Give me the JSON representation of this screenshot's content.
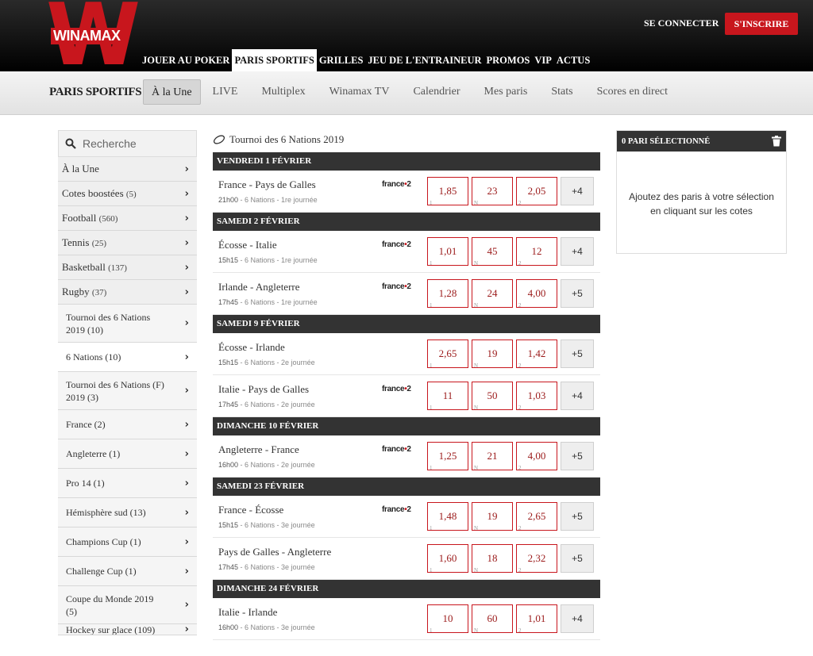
{
  "brand": {
    "name": "WINAMAX",
    "letter": "W",
    "red": "#c8161d"
  },
  "topnav": {
    "items": [
      "JOUER AU POKER",
      "PARIS SPORTIFS",
      "GRILLES",
      "JEU DE L'ENTRAINEUR",
      "PROMOS",
      "VIP",
      "ACTUS"
    ],
    "active": "PARIS SPORTIFS",
    "login": "SE CONNECTER",
    "register": "S'INSCRIRE"
  },
  "subnav": {
    "title": "PARIS SPORTIFS",
    "items": [
      "À la Une",
      "LIVE",
      "Multiplex",
      "Winamax TV",
      "Calendrier",
      "Mes paris",
      "Stats",
      "Scores en direct"
    ],
    "active": "À la Une"
  },
  "sidebar": {
    "search_placeholder": "Recherche",
    "top_items": [
      {
        "label": "À la Une",
        "count": ""
      },
      {
        "label": "Cotes boostées",
        "count": "(5)"
      },
      {
        "label": "Football",
        "count": "(560)"
      },
      {
        "label": "Tennis",
        "count": "(25)"
      },
      {
        "label": "Basketball",
        "count": "(137)"
      },
      {
        "label": "Rugby",
        "count": "(37)"
      }
    ],
    "sub_items": [
      {
        "label": "Tournoi des 6 Nations 2019 (10)",
        "selected": false
      },
      {
        "label": "6 Nations (10)",
        "selected": true
      },
      {
        "label": "Tournoi des 6 Nations (F) 2019 (3)",
        "selected": false
      },
      {
        "label": "France (2)",
        "selected": false
      },
      {
        "label": "Angleterre (1)",
        "selected": false
      },
      {
        "label": "Pro 14 (1)",
        "selected": false
      },
      {
        "label": "Hémisphère sud (13)",
        "selected": false
      },
      {
        "label": "Champions Cup (1)",
        "selected": false
      },
      {
        "label": "Challenge Cup (1)",
        "selected": false
      },
      {
        "label": "Coupe du Monde 2019 (5)",
        "selected": false
      },
      {
        "label": "Hockey sur glace (109)",
        "selected": false
      }
    ]
  },
  "content": {
    "title": "Tournoi des 6 Nations 2019",
    "tv_label": "france",
    "tv_channel": "2",
    "days": [
      {
        "day": "VENDREDI 1 FÉVRIER",
        "matches": [
          {
            "name": "France - Pays de Galles",
            "time": "21h00",
            "info": "6 Nations - 1re journée",
            "tv": true,
            "odds": [
              "1,85",
              "23",
              "2,05"
            ],
            "more": "+4"
          }
        ]
      },
      {
        "day": "SAMEDI 2 FÉVRIER",
        "matches": [
          {
            "name": "Écosse - Italie",
            "time": "15h15",
            "info": "6 Nations - 1re journée",
            "tv": true,
            "odds": [
              "1,01",
              "45",
              "12"
            ],
            "more": "+4"
          },
          {
            "name": "Irlande - Angleterre",
            "time": "17h45",
            "info": "6 Nations - 1re journée",
            "tv": true,
            "odds": [
              "1,28",
              "24",
              "4,00"
            ],
            "more": "+5"
          }
        ]
      },
      {
        "day": "SAMEDI 9 FÉVRIER",
        "matches": [
          {
            "name": "Écosse - Irlande",
            "time": "15h15",
            "info": "6 Nations - 2e journée",
            "tv": false,
            "odds": [
              "2,65",
              "19",
              "1,42"
            ],
            "more": "+5"
          },
          {
            "name": "Italie - Pays de Galles",
            "time": "17h45",
            "info": "6 Nations - 2e journée",
            "tv": true,
            "odds": [
              "11",
              "50",
              "1,03"
            ],
            "more": "+4"
          }
        ]
      },
      {
        "day": "DIMANCHE 10 FÉVRIER",
        "matches": [
          {
            "name": "Angleterre - France",
            "time": "16h00",
            "info": "6 Nations - 2e journée",
            "tv": true,
            "odds": [
              "1,25",
              "21",
              "4,00"
            ],
            "more": "+5"
          }
        ]
      },
      {
        "day": "SAMEDI 23 FÉVRIER",
        "matches": [
          {
            "name": "France - Écosse",
            "time": "15h15",
            "info": "6 Nations - 3e journée",
            "tv": true,
            "odds": [
              "1,48",
              "19",
              "2,65"
            ],
            "more": "+5"
          },
          {
            "name": "Pays de Galles - Angleterre",
            "time": "17h45",
            "info": "6 Nations - 3e journée",
            "tv": false,
            "odds": [
              "1,60",
              "18",
              "2,32"
            ],
            "more": "+5"
          }
        ]
      },
      {
        "day": "DIMANCHE 24 FÉVRIER",
        "matches": [
          {
            "name": "Italie - Irlande",
            "time": "16h00",
            "info": "6 Nations - 3e journée",
            "tv": false,
            "odds": [
              "10",
              "60",
              "1,01"
            ],
            "more": "+4"
          }
        ]
      }
    ],
    "odd_labels": [
      "1",
      "N",
      "2"
    ]
  },
  "betslip": {
    "title": "0 PARI SÉLECTIONNÉ",
    "message": "Ajoutez des paris à votre sélection en cliquant sur les cotes"
  }
}
